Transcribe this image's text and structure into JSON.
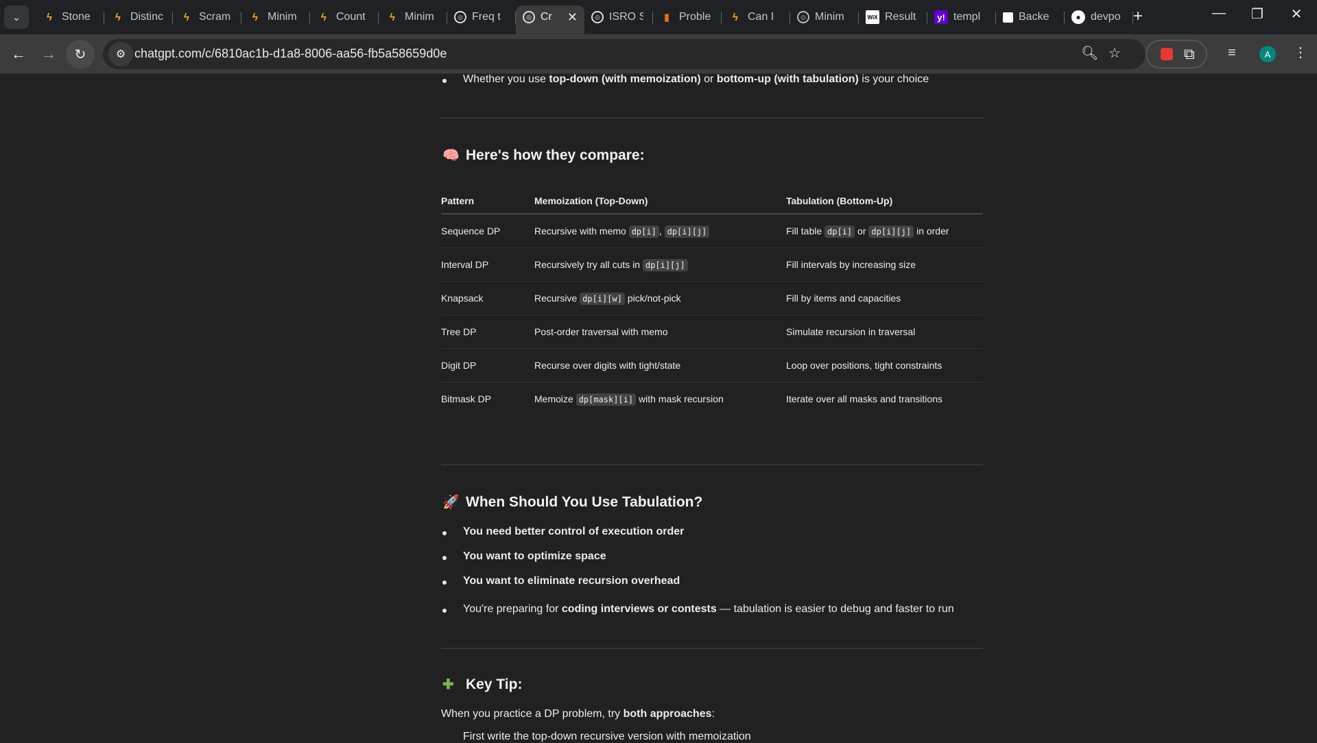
{
  "browser": {
    "tabs": [
      {
        "title": "Stone",
        "icon": "codeforces-icon"
      },
      {
        "title": "Distinc",
        "icon": "codeforces-icon"
      },
      {
        "title": "Scram",
        "icon": "codeforces-icon"
      },
      {
        "title": "Minim",
        "icon": "codeforces-icon"
      },
      {
        "title": "Count",
        "icon": "codeforces-icon"
      },
      {
        "title": "Minim",
        "icon": "codeforces-icon"
      },
      {
        "title": "Freq t",
        "icon": "chatgpt-icon"
      },
      {
        "title": "Cr",
        "icon": "chatgpt-icon",
        "active": true
      },
      {
        "title": "ISRO S",
        "icon": "chatgpt-icon"
      },
      {
        "title": "Proble",
        "icon": "bar-chart-icon"
      },
      {
        "title": "Can I",
        "icon": "codeforces-icon"
      },
      {
        "title": "Minim",
        "icon": "globe-icon"
      },
      {
        "title": "Result",
        "icon": "wix-icon"
      },
      {
        "title": "templ",
        "icon": "yahoo-icon"
      },
      {
        "title": "Backe",
        "icon": "back4app-icon"
      },
      {
        "title": "devpo",
        "icon": "github-icon"
      }
    ],
    "url": "chatgpt.com/c/6810ac1b-d1a8-8006-aa56-fb5a58659d0e",
    "avatar_letter": "A"
  },
  "content": {
    "top_bullet": {
      "pre": "Whether you use ",
      "b1": "top-down (with memoization)",
      "mid": " or ",
      "b2": "bottom-up (with tabulation)",
      "post": " is your choice"
    },
    "compare_heading": "Here's how they compare:",
    "table": {
      "headers": [
        "Pattern",
        "Memoization (Top-Down)",
        "Tabulation (Bottom-Up)"
      ],
      "rows": [
        {
          "pattern": "Sequence DP",
          "memo": [
            {
              "t": "Recursive with memo "
            },
            {
              "c": "dp[i]"
            },
            {
              "t": ", "
            },
            {
              "c": "dp[i][j]"
            }
          ],
          "tab": [
            {
              "t": "Fill table "
            },
            {
              "c": "dp[i]"
            },
            {
              "t": " or "
            },
            {
              "c": "dp[i][j]"
            },
            {
              "t": " in order"
            }
          ]
        },
        {
          "pattern": "Interval DP",
          "memo": [
            {
              "t": "Recursively try all cuts in "
            },
            {
              "c": "dp[i][j]"
            }
          ],
          "tab": [
            {
              "t": "Fill intervals by increasing size"
            }
          ]
        },
        {
          "pattern": "Knapsack",
          "memo": [
            {
              "t": "Recursive "
            },
            {
              "c": "dp[i][w]"
            },
            {
              "t": " pick/not-pick"
            }
          ],
          "tab": [
            {
              "t": "Fill by items and capacities"
            }
          ]
        },
        {
          "pattern": "Tree DP",
          "memo": [
            {
              "t": "Post-order traversal with memo"
            }
          ],
          "tab": [
            {
              "t": "Simulate recursion in traversal"
            }
          ]
        },
        {
          "pattern": "Digit DP",
          "memo": [
            {
              "t": "Recurse over digits with tight/state"
            }
          ],
          "tab": [
            {
              "t": "Loop over positions, tight constraints"
            }
          ]
        },
        {
          "pattern": "Bitmask DP",
          "memo": [
            {
              "t": "Memoize "
            },
            {
              "c": "dp[mask][i]"
            },
            {
              "t": " with mask recursion"
            }
          ],
          "tab": [
            {
              "t": "Iterate over all masks and transitions"
            }
          ]
        }
      ]
    },
    "tabulation_heading": "When Should You Use Tabulation?",
    "tabulation_bullets": [
      "You need better control of execution order",
      "You want to optimize space",
      "You want to eliminate recursion overhead"
    ],
    "last_bullet": {
      "pre": "You're preparing for ",
      "b": "coding interviews or contests",
      "post": " — tabulation is easier to debug and faster to run"
    },
    "key_tip_heading": "Key Tip:",
    "key_tip_text_pre": "When you practice a DP problem, try ",
    "key_tip_text_b": "both approaches",
    "key_tip_text_post": ":",
    "cut_line": "First write the top-down recursive version with memoization"
  }
}
